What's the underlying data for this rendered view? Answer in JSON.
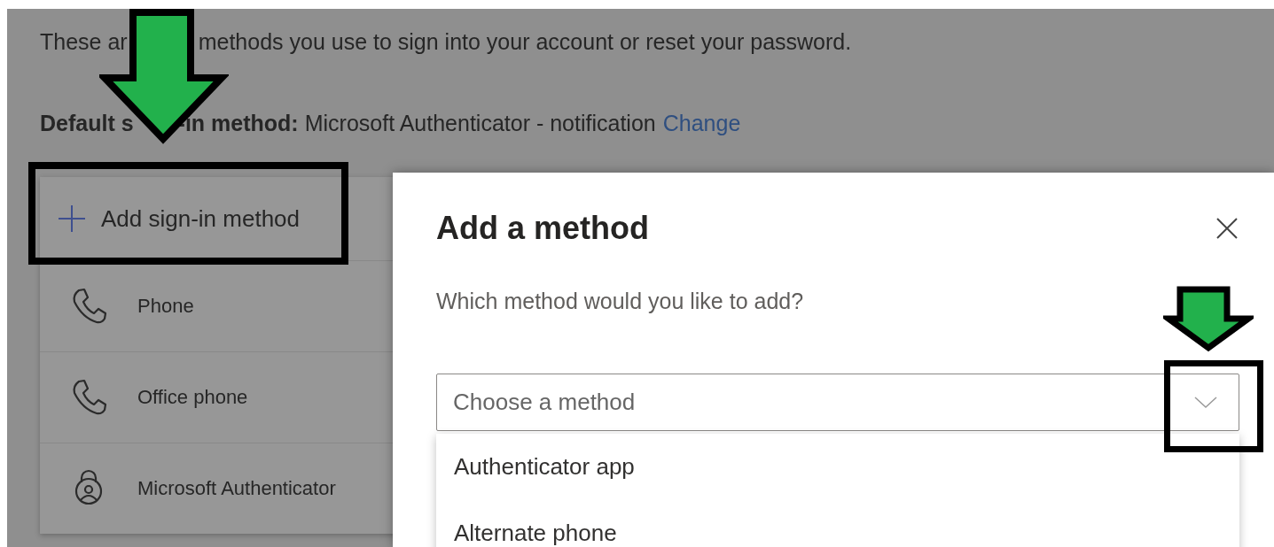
{
  "page": {
    "intro_segments": [
      "These ar",
      "methods you use to sign into your account or reset your password."
    ],
    "default_method": {
      "label_segments": [
        "Default s",
        "-in method:"
      ],
      "value": "Microsoft Authenticator - notification",
      "link": "Change"
    },
    "add_button": "Add sign-in method",
    "methods": [
      {
        "label": "Phone",
        "kind": "phone"
      },
      {
        "label": "Office phone",
        "kind": "phone"
      },
      {
        "label": "Microsoft Authenticator",
        "kind": "authenticator"
      }
    ]
  },
  "dialog": {
    "title": "Add a method",
    "prompt": "Which method would you like to add?",
    "select": {
      "placeholder": "Choose a method",
      "expanded": true
    },
    "options": [
      "Authenticator app",
      "Alternate phone"
    ]
  }
}
